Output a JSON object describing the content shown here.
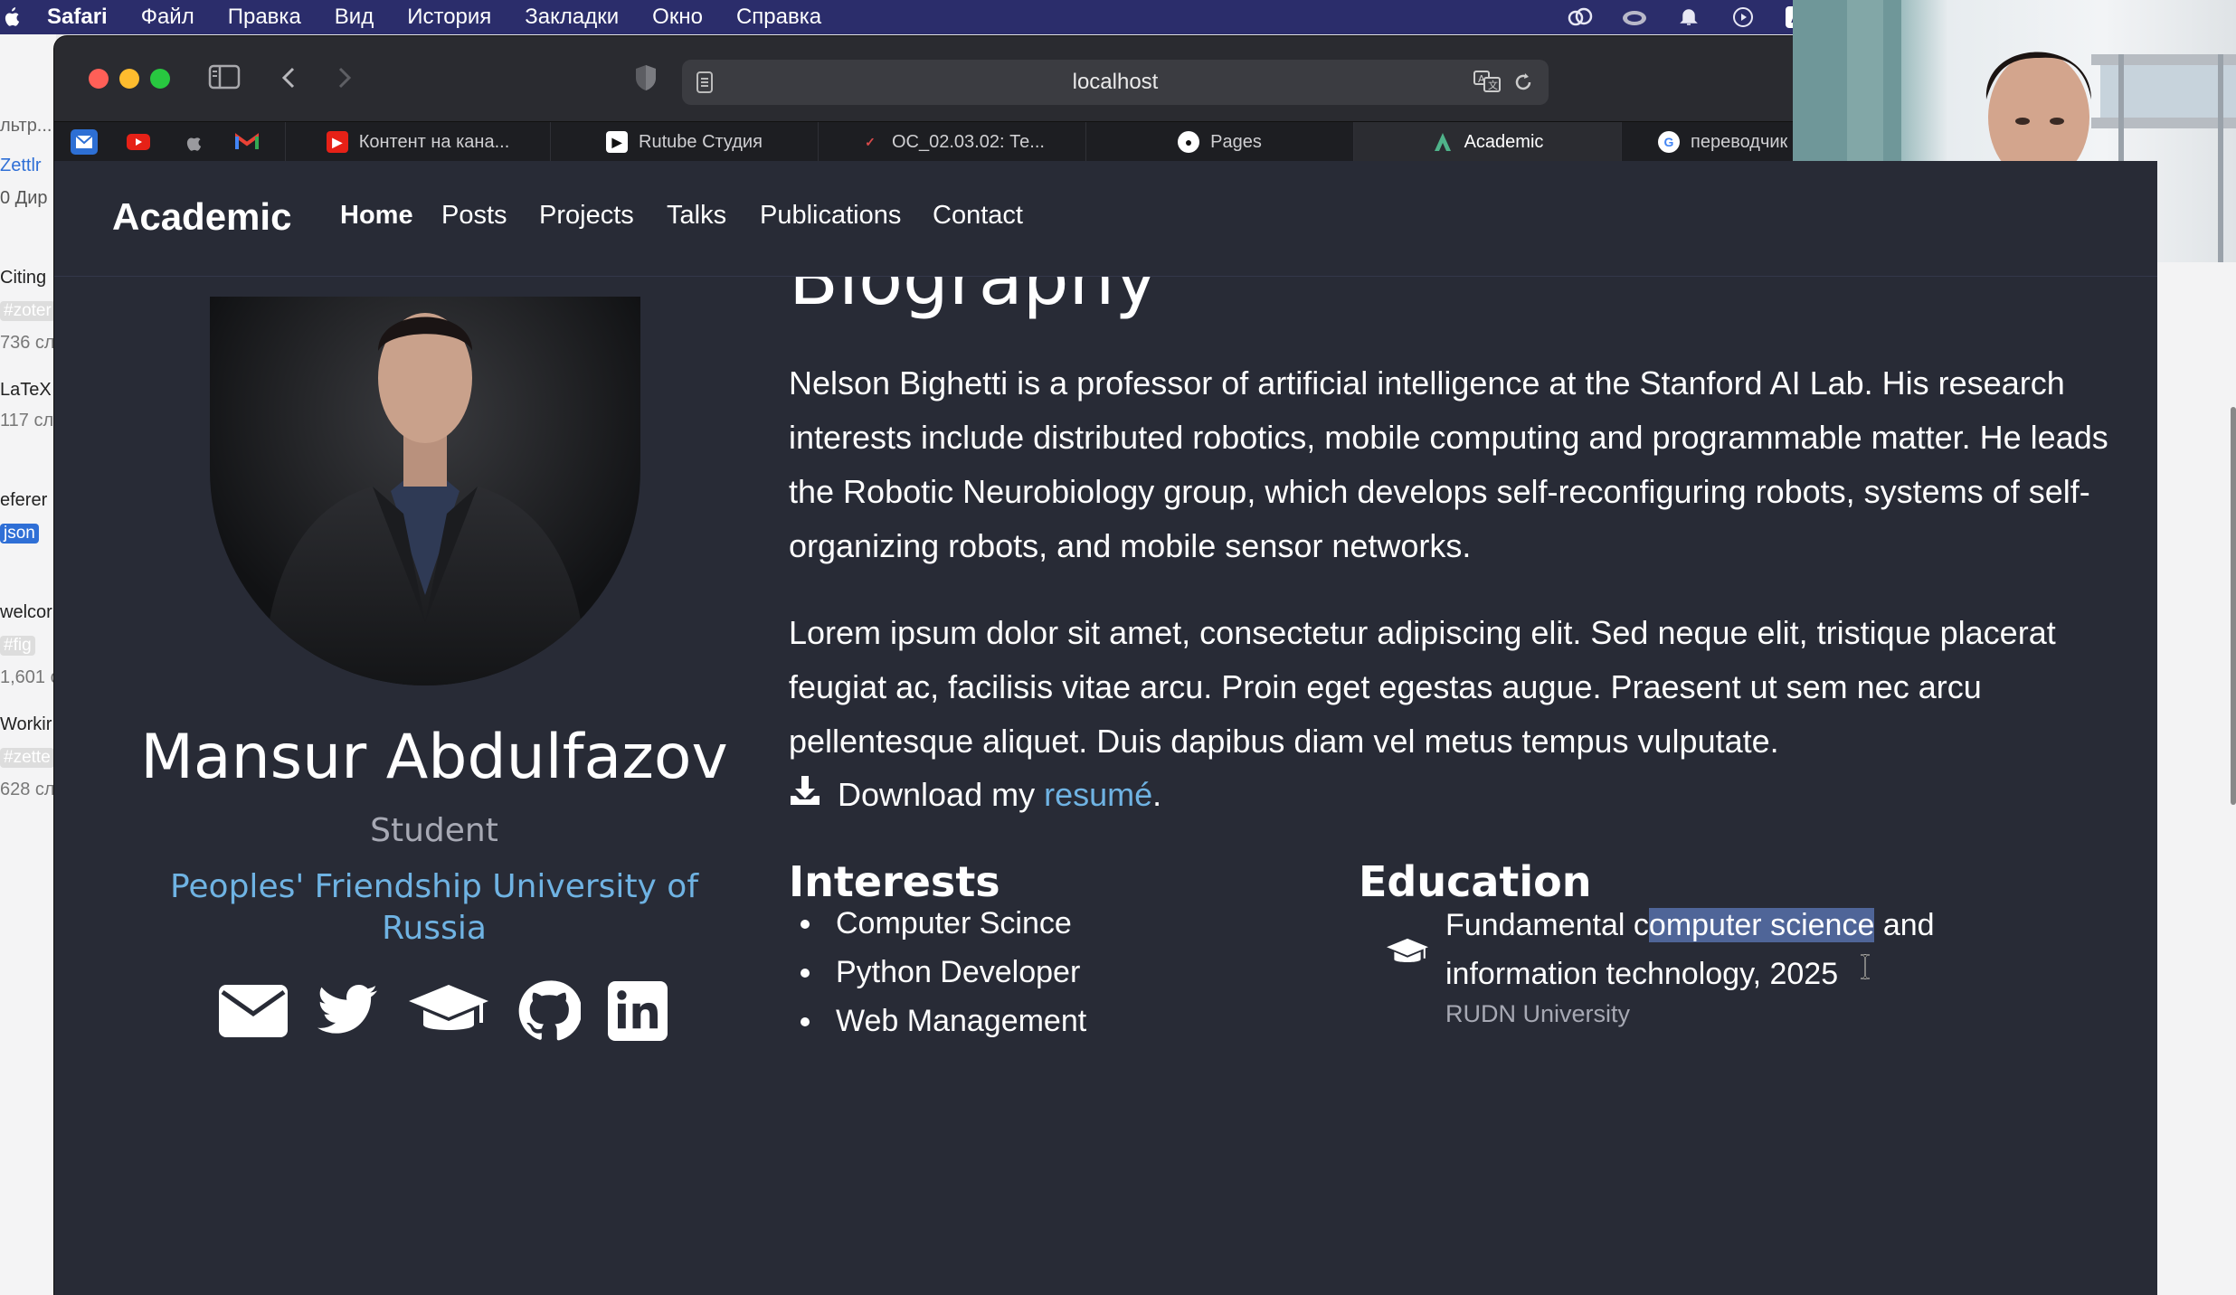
{
  "menubar": {
    "app": "Safari",
    "items": [
      "Файл",
      "Правка",
      "Вид",
      "История",
      "Закладки",
      "Окно",
      "Справка"
    ],
    "tray_icons": [
      "creative-cloud-icon",
      "cloud-icon",
      "notification-icon",
      "play-icon",
      "input-source-icon"
    ],
    "input_source": "A"
  },
  "background_app": {
    "items": [
      "льтр...",
      "Zettlr",
      "0 Дир",
      "Citing",
      "#zoter",
      "736 сл",
      "LaTeX",
      "117 сл",
      "eferer",
      "json",
      "welcor",
      "#fig",
      "1,601 с",
      "Workir",
      "#zette",
      "628 сл"
    ]
  },
  "browser": {
    "url": "localhost",
    "pinned_tabs": [
      "mail-icon",
      "youtube-icon",
      "apple-icon",
      "gmail-icon"
    ],
    "tabs": [
      {
        "label": "Контент на кана...",
        "icon": "youtube-icon"
      },
      {
        "label": "Rutube Студия",
        "icon": "rutube-icon"
      },
      {
        "label": "ОС_02.03.02: Те...",
        "icon": "course-icon"
      },
      {
        "label": "Pages",
        "icon": "github-icon"
      },
      {
        "label": "Academic",
        "icon": "academic-icon",
        "active": true
      },
      {
        "label": "переводчик",
        "icon": "google-icon"
      }
    ]
  },
  "site": {
    "brand": "Academic",
    "nav": [
      "Home",
      "Posts",
      "Projects",
      "Talks",
      "Publications",
      "Contact"
    ],
    "profile": {
      "name": "Mansur Abdulfazov",
      "role": "Student",
      "organization": "Peoples' Friendship University of Russia",
      "social": [
        "envelope-icon",
        "twitter-icon",
        "graduation-cap-icon",
        "github-icon",
        "linkedin-icon"
      ]
    },
    "biography": {
      "heading": "Biography",
      "para1": "Nelson Bighetti is a professor of artificial intelligence at the Stanford AI Lab. His research interests include distributed robotics, mobile computing and programmable matter. He leads the Robotic Neurobiology group, which develops self-reconfiguring robots, systems of self-organizing robots, and mobile sensor networks.",
      "para2": "Lorem ipsum dolor sit amet, consectetur adipiscing elit. Sed neque elit, tristique placerat feugiat ac, facilisis vitae arcu. Proin eget egestas augue. Praesent ut sem nec arcu pellentesque aliquet. Duis dapibus diam vel metus tempus vulputate.",
      "download_prefix": "Download my",
      "download_link": "resumé",
      "download_suffix": "."
    },
    "interests": {
      "heading": "Interests",
      "items": [
        "Computer Scince",
        "Python Developer",
        "Web Management"
      ]
    },
    "education": {
      "heading": "Education",
      "course_before": "Fundamental c",
      "course_selected": "omputer science",
      "course_after": " and information technology, 2025",
      "institution": "RUDN University"
    }
  }
}
